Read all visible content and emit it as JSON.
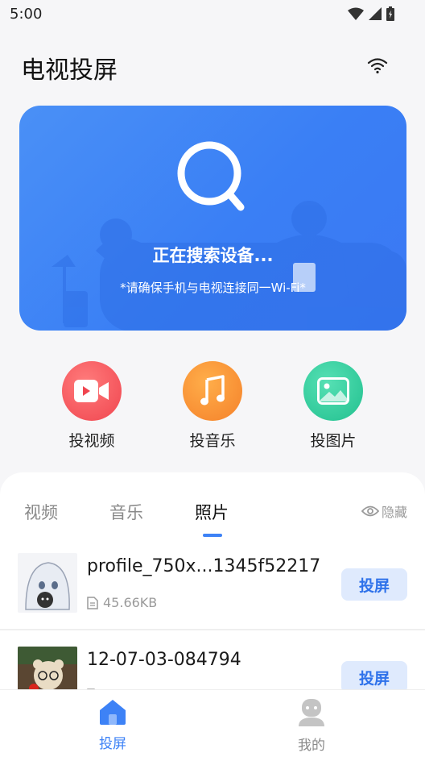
{
  "status_bar": {
    "time": "5:00"
  },
  "header": {
    "title": "电视投屏"
  },
  "search_card": {
    "status": "正在搜索设备...",
    "hint": "*请确保手机与电视连接同一Wi-Fi*"
  },
  "quick_actions": [
    {
      "label": "投视频",
      "color": "#f4605f",
      "icon": "video-icon"
    },
    {
      "label": "投音乐",
      "color": "#f9923a",
      "icon": "music-icon"
    },
    {
      "label": "投图片",
      "color": "#33cfa2",
      "icon": "image-icon"
    }
  ],
  "tabs": [
    {
      "label": "视频",
      "active": false
    },
    {
      "label": "音乐",
      "active": false
    },
    {
      "label": "照片",
      "active": true
    }
  ],
  "hide_label": "隐藏",
  "files": [
    {
      "name": "profile_750x...1345f52217",
      "size": "45.66KB",
      "action": "投屏"
    },
    {
      "name": "12-07-03-084794",
      "size": "",
      "action": "投屏"
    }
  ],
  "bottom_nav": [
    {
      "label": "投屏",
      "active": true,
      "color": "#3d82f6"
    },
    {
      "label": "我的",
      "active": false,
      "color": "#8a8a8a"
    }
  ]
}
